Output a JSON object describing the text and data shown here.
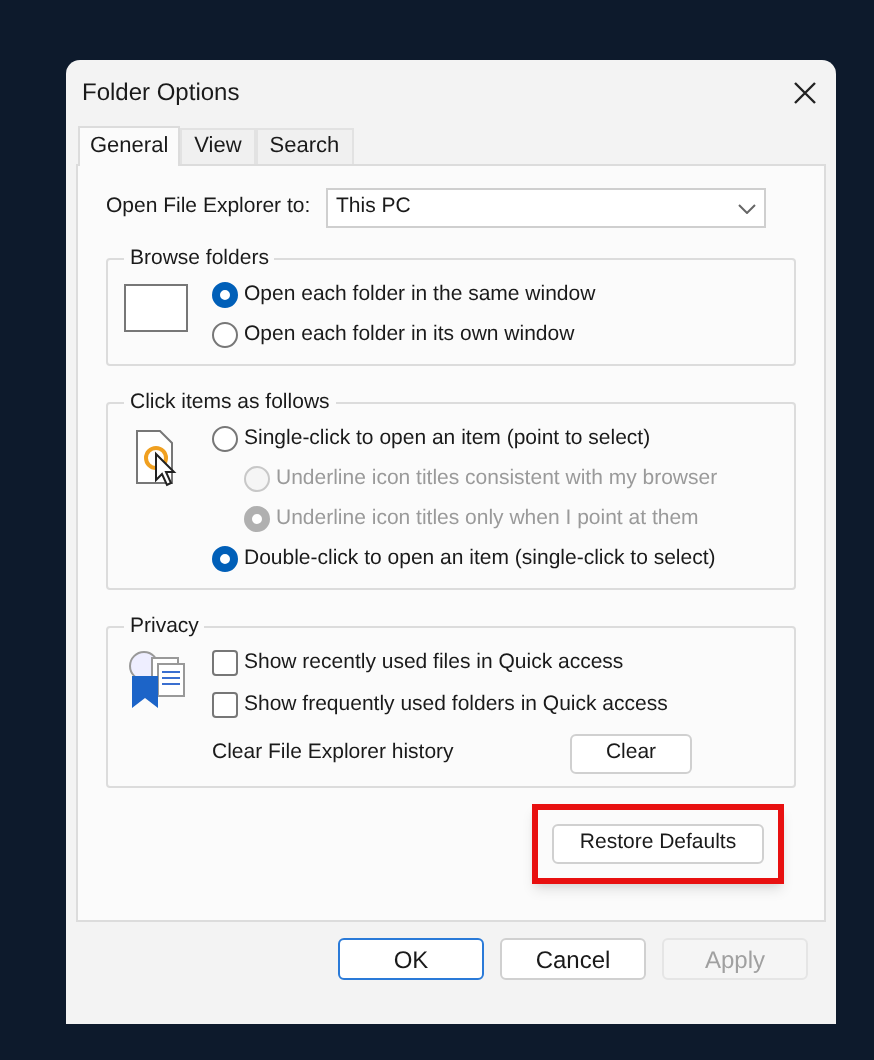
{
  "window": {
    "title": "Folder Options"
  },
  "tabs": [
    {
      "label": "General",
      "selected": true
    },
    {
      "label": "View",
      "selected": false
    },
    {
      "label": "Search",
      "selected": false
    }
  ],
  "open_explorer": {
    "label": "Open File Explorer to:",
    "value": "This PC"
  },
  "groups": [
    {
      "title": "Browse folders",
      "options": [
        {
          "kind": "radio",
          "label": "Open each folder in the same window",
          "selected": true,
          "disabled": false
        },
        {
          "kind": "radio",
          "label": "Open each folder in its own window",
          "selected": false,
          "disabled": false
        }
      ]
    },
    {
      "title": "Click items as follows",
      "options": [
        {
          "kind": "radio",
          "label": "Single-click to open an item (point to select)",
          "selected": false,
          "disabled": false,
          "children": [
            {
              "kind": "radio",
              "label": "Underline icon titles consistent with my browser",
              "selected": false,
              "disabled": true
            },
            {
              "kind": "radio",
              "label": "Underline icon titles only when I point at them",
              "selected": true,
              "disabled": true
            }
          ]
        },
        {
          "kind": "radio",
          "label": "Double-click to open an item (single-click to select)",
          "selected": true,
          "disabled": false
        }
      ]
    },
    {
      "title": "Privacy",
      "options": [
        {
          "kind": "checkbox",
          "label": "Show recently used files in Quick access",
          "checked": false
        },
        {
          "kind": "checkbox",
          "label": "Show frequently used folders in Quick access",
          "checked": false
        }
      ],
      "action": {
        "label": "Clear File Explorer history",
        "button": "Clear"
      }
    }
  ],
  "restore_button": {
    "label": "Restore Defaults",
    "highlighted": true
  },
  "buttons": [
    {
      "label": "OK",
      "default": true,
      "disabled": false
    },
    {
      "label": "Cancel",
      "default": false,
      "disabled": false
    },
    {
      "label": "Apply",
      "default": false,
      "disabled": true
    }
  ]
}
